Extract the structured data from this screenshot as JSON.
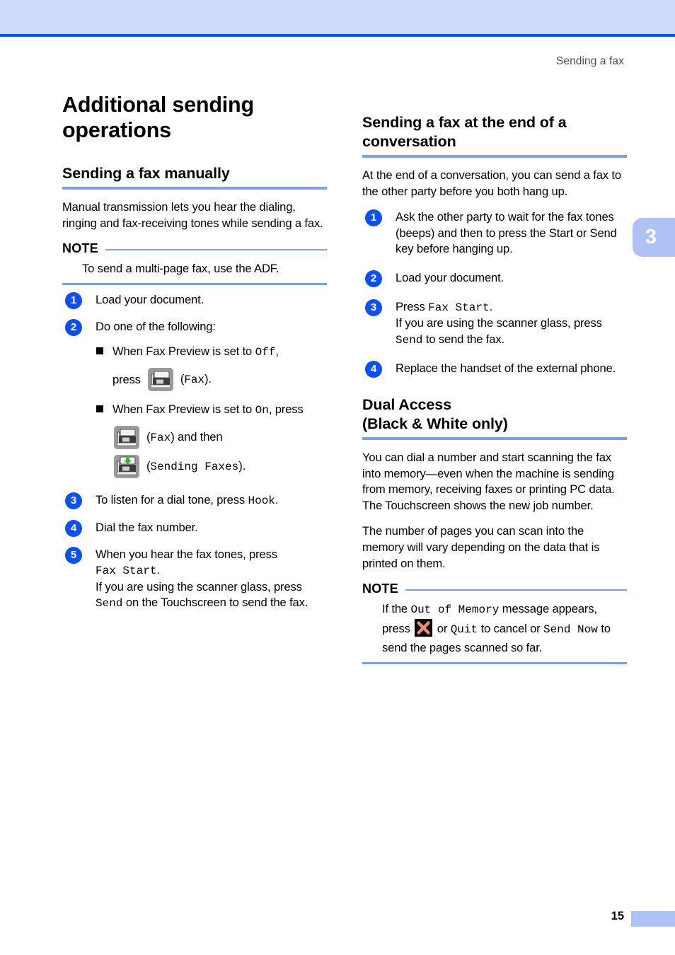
{
  "page": {
    "running_head": "Sending a fax",
    "chapter_tab": "3",
    "page_number": "15"
  },
  "left_column": {
    "chapter_title": "Additional sending operations",
    "section": {
      "title": "Sending a fax manually",
      "intro": "Manual transmission lets you hear the dialing, ringing and fax-receiving tones while sending a fax.",
      "note": {
        "label": "NOTE",
        "text": "To send a multi-page fax, use the ADF."
      },
      "steps": [
        {
          "num": "1",
          "text": "Load your document."
        },
        {
          "num": "2",
          "text": "Do one of the following:"
        },
        {
          "num": "3",
          "text_pre": "To listen for a dial tone, press ",
          "mono": "Hook",
          "text_post": "."
        },
        {
          "num": "4",
          "text": "Dial the fax number."
        },
        {
          "num": "5",
          "line1": "When you hear the fax tones, press",
          "mono1": "Fax Start",
          "after_mono1": ".",
          "line2": "If you are using the scanner glass, press",
          "mono2": "Send",
          "line2_cont": " on the Touchscreen to send the fax."
        }
      ],
      "bullets": [
        {
          "text_pre": "When Fax Preview is set to ",
          "mono": "Off",
          "text_post": ",",
          "press_label": "press",
          "icon": "fax-machine-icon",
          "paren_mono": "Fax",
          "paren_post": ")."
        },
        {
          "text_pre": "When Fax Preview is set to ",
          "mono": "On",
          "text_post": ", press",
          "icon_rows": [
            {
              "icon": "fax-machine-icon",
              "paren_mono": "Fax",
              "paren_post": ") and then"
            },
            {
              "icon": "sending-faxes-icon",
              "paren_mono": "Sending Faxes",
              "paren_post": ")."
            }
          ]
        }
      ]
    }
  },
  "right_column": {
    "section_one": {
      "title": "Sending a fax at the end of a conversation",
      "intro": "At the end of a conversation, you can send a fax to the other party before you both hang up.",
      "steps": [
        {
          "num": "1",
          "text": "Ask the other party to wait for the fax tones (beeps) and then to press the Start or Send key before hanging up."
        },
        {
          "num": "2",
          "text": "Load your document."
        },
        {
          "num": "3",
          "line1_pre": "Press ",
          "mono1": "Fax Start",
          "line1_post": ".",
          "line2": "If you are using the scanner glass, press",
          "mono2": "Send",
          "line2_cont": " to send the fax."
        },
        {
          "num": "4",
          "text": "Replace the handset of the external phone."
        }
      ]
    },
    "section_two": {
      "title": "Dual Access (Black & White only)",
      "title_line1": "Dual Access",
      "title_line2": "(Black & White only)",
      "paragraph_1": "You can dial a number and start scanning the fax into memory—even when the machine is sending from memory, receiving faxes or printing PC data. The Touchscreen shows the new job number.",
      "paragraph_2": "The number of pages you can scan into the memory will vary depending on the data that is printed on them.",
      "note": {
        "label": "NOTE",
        "text_1": "If the",
        "mono_1": "Out of Memory",
        "text_2": "message appears, press",
        "icon": "cancel-x-icon",
        "text_3": "or",
        "mono_2": "Quit",
        "text_4": "to cancel or",
        "mono_3": "Send Now",
        "text_5": "to send the pages scanned so far."
      }
    }
  },
  "colors": {
    "band": "#cfdcfb",
    "rule": "#0054f0",
    "section_rule": "#7c9ef2",
    "badge": "#0d4ff0",
    "tab": "#aec2f6",
    "x_icon": "#f08a7a"
  }
}
